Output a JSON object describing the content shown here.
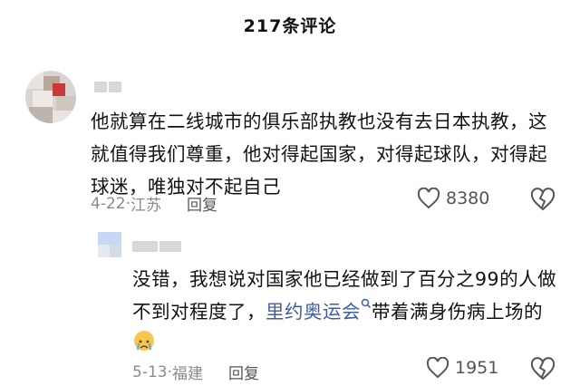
{
  "header": {
    "title": "217条评论"
  },
  "comments": [
    {
      "text": "他就算在二线城市的俱乐部执教也没有去日本执教，这就值得我们尊重，他对得起国家，对得起球队，对得起球迷，唯独对不起自己",
      "date": "4-22",
      "location": "江苏",
      "reply_label": "回复",
      "likes": "8380"
    },
    {
      "text_before_link": "没错，我想说对国家他已经做到了百分之99的人做不到对程度了，",
      "link_text": "里约奥运会",
      "text_after_link": "带着满身伤病上场的",
      "date": "5-13",
      "location": "福建",
      "reply_label": "回复",
      "likes": "1951"
    }
  ],
  "icons": {
    "like": "heart-outline-icon",
    "dislike": "broken-heart-icon",
    "search": "search-icon",
    "emoji": "crying-face-emoji"
  }
}
